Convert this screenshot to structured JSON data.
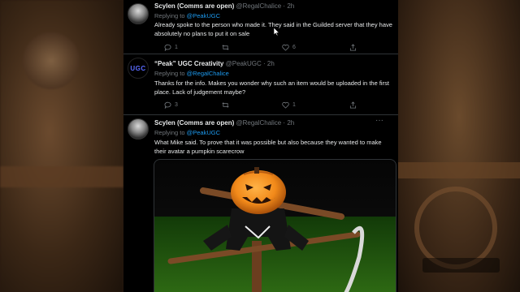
{
  "tweets": [
    {
      "name": "Scylen (Comms are open)",
      "handle": "@RegalChalice",
      "dot": "·",
      "time": "2h",
      "replying_prefix": "Replying to",
      "replying_to": "@PeakUGC",
      "text": "Already spoke to the person who made it. They said in the Guilded server that they have absolutely no plans to put it on sale",
      "replies": "1",
      "retweets": "",
      "likes": "6"
    },
    {
      "name": "“Peak” UGC Creativity",
      "handle": "@PeakUGC",
      "dot": "·",
      "time": "2h",
      "avatar_text": "UGC",
      "replying_prefix": "Replying to",
      "replying_to": "@RegalChalice",
      "text": "Thanks for the info. Makes you wonder why such an item would be uploaded in the first place. Lack of judgement maybe?",
      "replies": "3",
      "retweets": "",
      "likes": "1"
    },
    {
      "name": "Scylen (Comms are open)",
      "handle": "@RegalChalice",
      "dot": "·",
      "time": "2h",
      "replying_prefix": "Replying to",
      "replying_to": "@PeakUGC",
      "text": "What Mike said. To prove that it was possible but also because they wanted to make their avatar a pumpkin scarecrow",
      "more": "···"
    }
  ],
  "colors": {
    "background": "#000000",
    "text": "#e7e9ea",
    "muted": "#71767b",
    "link": "#1d9bf0",
    "divider": "#2f3336",
    "ugc_brand": "#5a6bff",
    "pumpkin": "#f28a1a"
  },
  "icons": [
    "reply-icon",
    "retweet-icon",
    "like-icon",
    "share-icon",
    "more-icon"
  ]
}
